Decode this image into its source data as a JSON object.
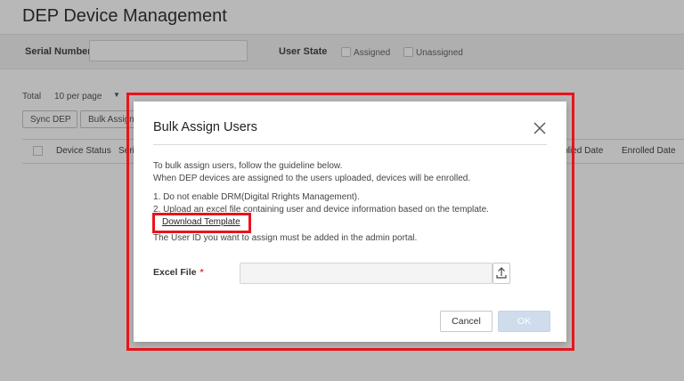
{
  "page": {
    "title": "DEP Device Management",
    "filters": {
      "serial_label": "Serial Number",
      "serial_value": "",
      "user_state_label": "User State",
      "assigned_label": "Assigned",
      "unassigned_label": "Unassigned"
    },
    "toolbar": {
      "total_label": "Total",
      "per_page": "10 per page",
      "sync_button": "Sync DEP",
      "bulk_button": "Bulk Assign Users"
    },
    "table": {
      "col_device_status": "Device Status",
      "col_serial": "Serial Number",
      "col_applied_date": "Applied Date",
      "col_enrolled_date": "Enrolled Date"
    }
  },
  "modal": {
    "title": "Bulk Assign Users",
    "desc_line1": "To bulk assign users, follow the guideline below.",
    "desc_line2": "When DEP devices are assigned to the users uploaded, devices will be enrolled.",
    "step1": "1. Do not enable DRM(Digital Rrights Management).",
    "step2": "2. Upload an excel file containing user and device information based on the template.",
    "download_link": "Download Template",
    "note": "The User ID you want to assign must be added in the admin portal.",
    "excel_label": "Excel File",
    "required_mark": "*",
    "file_value": "",
    "cancel_label": "Cancel",
    "ok_label": "OK"
  },
  "colors": {
    "highlight": "#e8141c",
    "required": "#e0332f",
    "ok_disabled": "#cfdcec"
  }
}
